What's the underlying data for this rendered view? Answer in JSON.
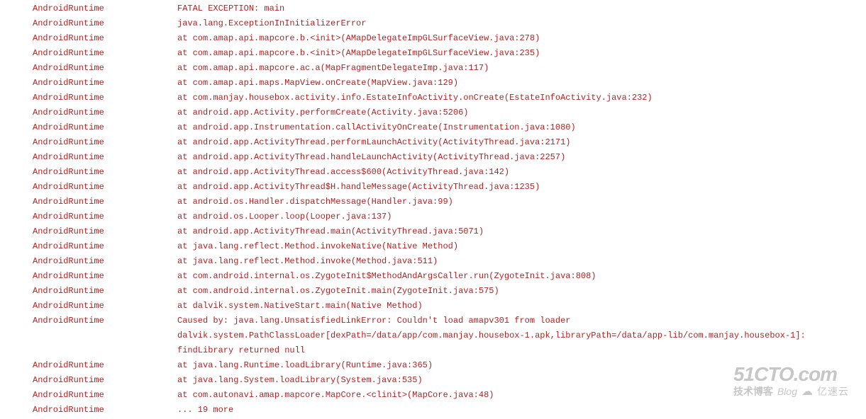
{
  "log": {
    "tag": "AndroidRuntime",
    "lines": [
      "FATAL EXCEPTION: main",
      "java.lang.ExceptionInInitializerError",
      "at com.amap.api.mapcore.b.<init>(AMapDelegateImpGLSurfaceView.java:278)",
      "at com.amap.api.mapcore.b.<init>(AMapDelegateImpGLSurfaceView.java:235)",
      "at com.amap.api.mapcore.ac.a(MapFragmentDelegateImp.java:117)",
      "at com.amap.api.maps.MapView.onCreate(MapView.java:129)",
      "at com.manjay.housebox.activity.info.EstateInfoActivity.onCreate(EstateInfoActivity.java:232)",
      "at android.app.Activity.performCreate(Activity.java:5206)",
      "at android.app.Instrumentation.callActivityOnCreate(Instrumentation.java:1080)",
      "at android.app.ActivityThread.performLaunchActivity(ActivityThread.java:2171)",
      "at android.app.ActivityThread.handleLaunchActivity(ActivityThread.java:2257)",
      "at android.app.ActivityThread.access$600(ActivityThread.java:142)",
      "at android.app.ActivityThread$H.handleMessage(ActivityThread.java:1235)",
      "at android.os.Handler.dispatchMessage(Handler.java:99)",
      "at android.os.Looper.loop(Looper.java:137)",
      "at android.app.ActivityThread.main(ActivityThread.java:5071)",
      "at java.lang.reflect.Method.invokeNative(Native Method)",
      "at java.lang.reflect.Method.invoke(Method.java:511)",
      "at com.android.internal.os.ZygoteInit$MethodAndArgsCaller.run(ZygoteInit.java:808)",
      "at com.android.internal.os.ZygoteInit.main(ZygoteInit.java:575)",
      "at dalvik.system.NativeStart.main(Native Method)",
      "Caused by: java.lang.UnsatisfiedLinkError: Couldn't load amapv301 from loader dalvik.system.PathClassLoader[dexPath=/data/app/com.manjay.housebox-1.apk,libraryPath=/data/app-lib/com.manjay.housebox-1]: findLibrary returned null",
      "at java.lang.Runtime.loadLibrary(Runtime.java:365)",
      "at java.lang.System.loadLibrary(System.java:535)",
      "at com.autonavi.amap.mapcore.MapCore.<clinit>(MapCore.java:48)",
      "... 19 more"
    ]
  },
  "watermark": {
    "domain": "51CTO.com",
    "cn": "技术博客",
    "blog": "Blog",
    "cloud_icon": "☁",
    "brand": "亿速云"
  }
}
